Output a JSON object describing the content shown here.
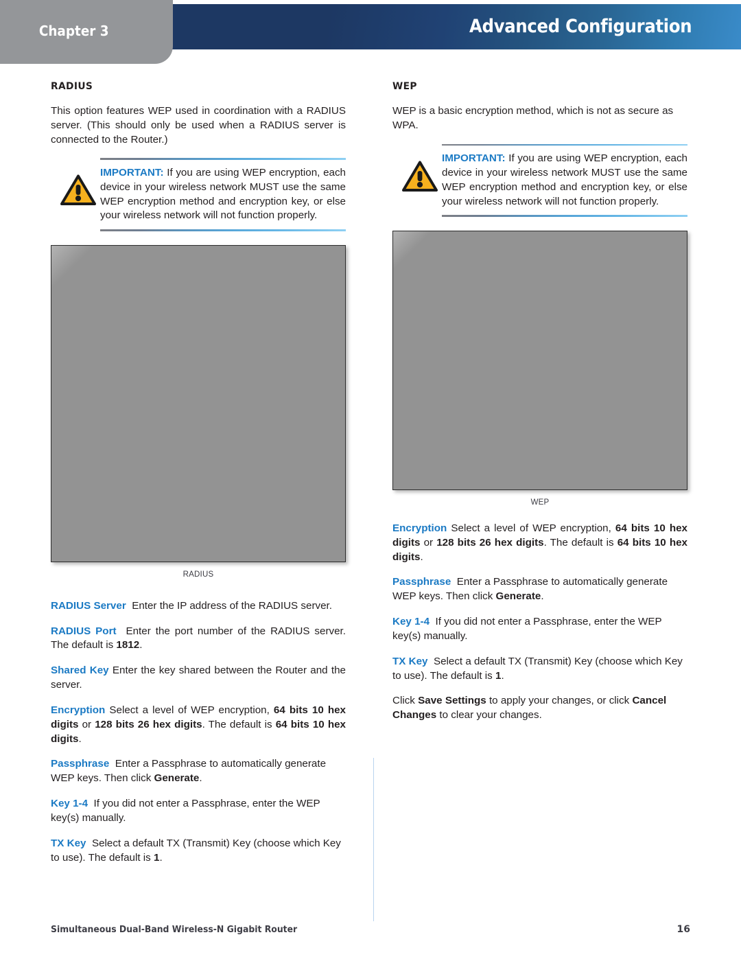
{
  "header": {
    "chapter_label": "Chapter 3",
    "title": "Advanced Configuration",
    "accent_dark": "#1d3863",
    "accent_light": "#3a8bc9",
    "tab_color": "#949699"
  },
  "left_column": {
    "section_title": "RADIUS",
    "intro": "This option features WEP used in coordination with a RADIUS server. (This should only be used when a RADIUS server is connected to the Router.)",
    "callout": {
      "label": "IMPORTANT:",
      "text": "If you are using WEP encryption, each device in your wireless network MUST use the same WEP encryption method and encryption key, or else your wireless network will not function properly.",
      "icon": "warning-triangle-icon"
    },
    "figure_caption": "RADIUS",
    "entries": [
      {
        "term": "RADIUS Server",
        "text": "Enter the IP address of the RADIUS server."
      },
      {
        "term": "RADIUS Port",
        "text": "Enter the port number of the RADIUS server. The default is 1812.",
        "strong": [
          "1812"
        ]
      },
      {
        "term": "Shared Key",
        "text": "Enter the key shared between the Router and the server."
      },
      {
        "term": "Encryption",
        "text": "Select a level of WEP encryption, 64 bits 10 hex digits or 128 bits 26 hex digits. The default is 64 bits 10 hex digits.",
        "strong": [
          "64 bits 10 hex digits",
          "128 bits 26 hex digits"
        ]
      },
      {
        "term": "Passphrase",
        "text": "Enter a Passphrase to automatically generate WEP keys. Then click Generate.",
        "strong": [
          "Generate"
        ]
      },
      {
        "term": "Key 1-4",
        "text": "If you did not enter a Passphrase, enter the WEP key(s) manually."
      },
      {
        "term": "TX Key",
        "text": "Select a default TX (Transmit) Key (choose which Key to use). The default is 1.",
        "strong": [
          "1"
        ]
      }
    ]
  },
  "right_column": {
    "section_title": "WEP",
    "intro": "WEP is a basic encryption method, which is not as secure as WPA.",
    "callout": {
      "label": "IMPORTANT:",
      "text": "If you are using WEP encryption, each device in your wireless network MUST use the same WEP encryption method and encryption key, or else your wireless network will not function properly.",
      "icon": "warning-triangle-icon"
    },
    "figure_caption": "WEP",
    "entries": [
      {
        "term": "Encryption",
        "text": "Select a level of WEP encryption, 64 bits 10 hex digits or 128 bits 26 hex digits. The default is 64 bits 10 hex digits.",
        "strong": [
          "64 bits 10 hex digits",
          "128 bits 26 hex digits"
        ]
      },
      {
        "term": "Passphrase",
        "text": "Enter a Passphrase to automatically generate WEP keys. Then click Generate.",
        "strong": [
          "Generate"
        ]
      },
      {
        "term": "Key 1-4",
        "text": "If you did not enter a Passphrase, enter the WEP key(s) manually."
      },
      {
        "term": "TX Key",
        "text": "Select a default TX (Transmit) Key (choose which Key to use). The default is 1.",
        "strong": [
          "1"
        ]
      }
    ],
    "closing": "Click Save Settings to apply your changes, or click Cancel Changes to clear your changes.",
    "closing_strong": [
      "Save Settings",
      "Cancel Changes"
    ]
  },
  "footer": {
    "product": "Simultaneous Dual-Band Wireless-N Gigabit Router",
    "page_number": "16"
  }
}
